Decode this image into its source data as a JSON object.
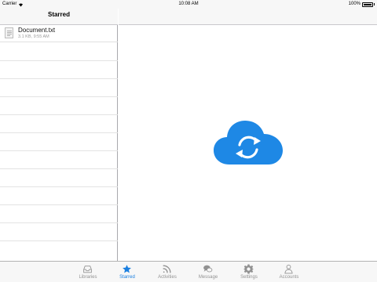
{
  "status_bar": {
    "carrier": "Carrier",
    "time": "10:08 AM",
    "battery": "100%"
  },
  "left_pane": {
    "title": "Starred",
    "files": [
      {
        "name": "Document.txt",
        "meta": "3.1 KB, 9:55 AM"
      }
    ]
  },
  "tab_bar": {
    "tabs": [
      {
        "label": "Libraries",
        "icon": "inbox-icon",
        "active": false
      },
      {
        "label": "Starred",
        "icon": "star-icon",
        "active": true
      },
      {
        "label": "Activities",
        "icon": "rss-icon",
        "active": false
      },
      {
        "label": "Message",
        "icon": "chat-icon",
        "active": false
      },
      {
        "label": "Settings",
        "icon": "gear-icon",
        "active": false
      },
      {
        "label": "Accounts",
        "icon": "person-icon",
        "active": false
      }
    ]
  },
  "colors": {
    "accent": "#1a7fe0",
    "cloud": "#1e88e5",
    "inactive": "#929292"
  }
}
